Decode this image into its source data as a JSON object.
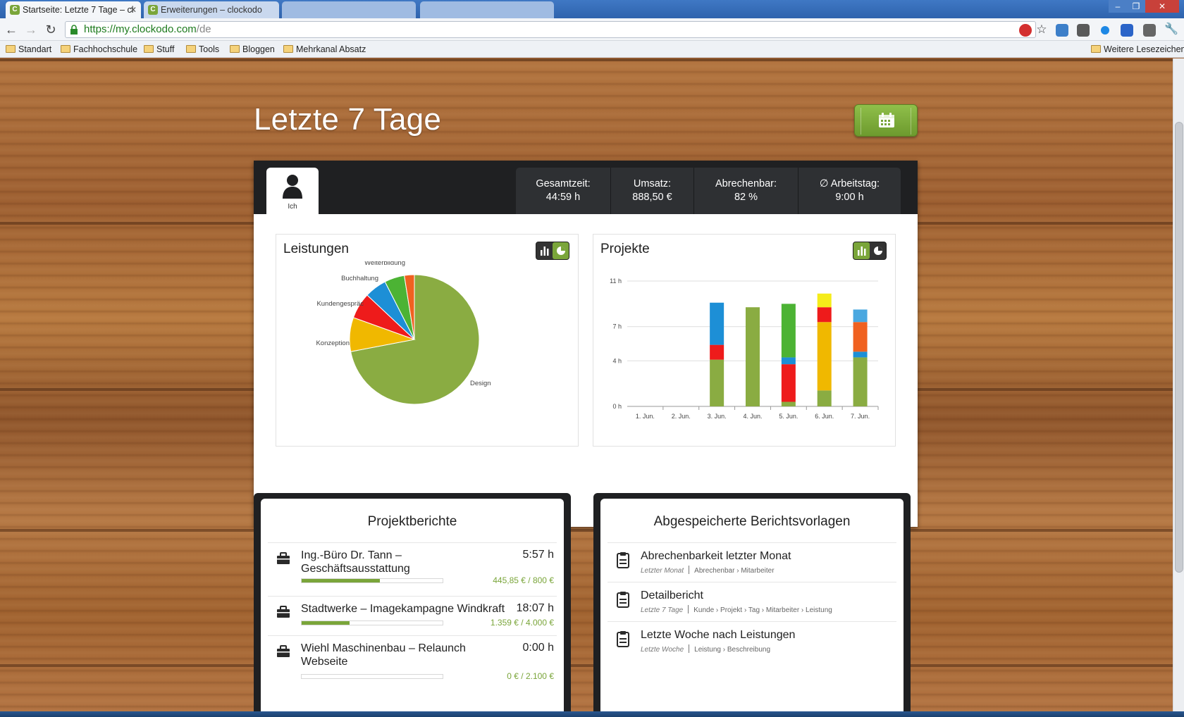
{
  "browser": {
    "tabs": [
      {
        "title": "Startseite: Letzte 7 Tage – cl",
        "active": true
      },
      {
        "title": "Erweiterungen – clockodo",
        "active": false
      }
    ],
    "url_scheme": "https://",
    "url_host": "my.clockodo.com",
    "url_path": "/de",
    "bookmarks": [
      "Standart",
      "Fachhochschule",
      "Stuff",
      "Tools",
      "Bloggen",
      "Mehrkanal Absatz"
    ],
    "other_bookmarks": "Weitere Lesezeichen"
  },
  "page": {
    "title": "Letzte 7 Tage",
    "user_label": "Ich",
    "stats": [
      {
        "label": "Gesamtzeit:",
        "value": "44:59 h"
      },
      {
        "label": "Umsatz:",
        "value": "888,50 €"
      },
      {
        "label": "Abrechenbar:",
        "value": "82 %"
      },
      {
        "label": "∅ Arbeitstag:",
        "value": "9:00 h"
      }
    ]
  },
  "chart_data": [
    {
      "type": "pie",
      "title": "Leistungen",
      "categories": [
        "Design",
        "Konzeption",
        "Kundengespräch",
        "Buchhaltung",
        "Weiterbildung",
        ""
      ],
      "labels_shown": [
        "Design",
        "Konzeption",
        "Kundengespräc",
        "Buchhaltung",
        "Weiterbildung"
      ],
      "values": [
        72,
        8.5,
        6.5,
        5.5,
        5,
        2.5
      ],
      "colors": [
        "#8aac42",
        "#f0b800",
        "#ee1b1b",
        "#1d8fd6",
        "#4cb334",
        "#f06120"
      ]
    },
    {
      "type": "bar",
      "stacked": true,
      "title": "Projekte",
      "categories": [
        "1. Jun.",
        "2. Jun.",
        "3. Jun.",
        "4. Jun.",
        "5. Jun.",
        "6. Jun.",
        "7. Jun."
      ],
      "yticks": [
        "0 h",
        "4 h",
        "7 h",
        "11 h"
      ],
      "ylim": [
        0,
        11
      ],
      "grid": true,
      "series": [
        {
          "color": "#8aac42",
          "values": [
            0,
            0,
            4.1,
            8.7,
            0.4,
            1.4,
            4.3
          ]
        },
        {
          "color": "#ee1b1b",
          "values": [
            0,
            0,
            1.3,
            0,
            3.3,
            0,
            0
          ]
        },
        {
          "color": "#1d8fd6",
          "values": [
            0,
            0,
            3.7,
            0,
            0.6,
            0,
            0.5
          ]
        },
        {
          "color": "#4cb334",
          "values": [
            0,
            0,
            0,
            0,
            4.7,
            0,
            0
          ]
        },
        {
          "color": "#f0b800",
          "values": [
            0,
            0,
            0,
            0,
            0,
            6.0,
            0
          ]
        },
        {
          "color": "#ee1b1b",
          "values": [
            0,
            0,
            0,
            0,
            0,
            1.3,
            0
          ]
        },
        {
          "color": "#f5ec1a",
          "values": [
            0,
            0,
            0,
            0,
            0,
            1.2,
            0
          ]
        },
        {
          "color": "#f06120",
          "values": [
            0,
            0,
            0,
            0,
            0,
            0,
            2.6
          ]
        },
        {
          "color": "#4aa8e0",
          "values": [
            0,
            0,
            0,
            0,
            0,
            0,
            1.1
          ]
        }
      ]
    }
  ],
  "reports": {
    "title": "Projektberichte",
    "items": [
      {
        "name": "Ing.-Büro Dr. Tann – Geschäftsausstattung",
        "hours": "5:57 h",
        "money": "445,85 € / 800 €",
        "progress": 0.557
      },
      {
        "name": "Stadtwerke – Imagekampagne Windkraft",
        "hours": "18:07 h",
        "money": "1.359 € / 4.000 €",
        "progress": 0.34
      },
      {
        "name": "Wiehl Maschinenbau – Relaunch Webseite",
        "hours": "0:00 h",
        "money": "0 € / 2.100 €",
        "progress": 0
      }
    ]
  },
  "templates": {
    "title": "Abgespeicherte Berichtsvorlagen",
    "items": [
      {
        "name": "Abrechenbarkeit letzter Monat",
        "period": "Letzter Monat",
        "path": [
          "Abrechenbar",
          "Mitarbeiter"
        ]
      },
      {
        "name": "Detailbericht",
        "period": "Letzte 7 Tage",
        "path": [
          "Kunde",
          "Projekt",
          "Tag",
          "Mitarbeiter",
          "Leistung"
        ]
      },
      {
        "name": "Letzte Woche nach Leistungen",
        "period": "Letzte Woche",
        "path": [
          "Leistung",
          "Beschreibung"
        ]
      }
    ]
  }
}
